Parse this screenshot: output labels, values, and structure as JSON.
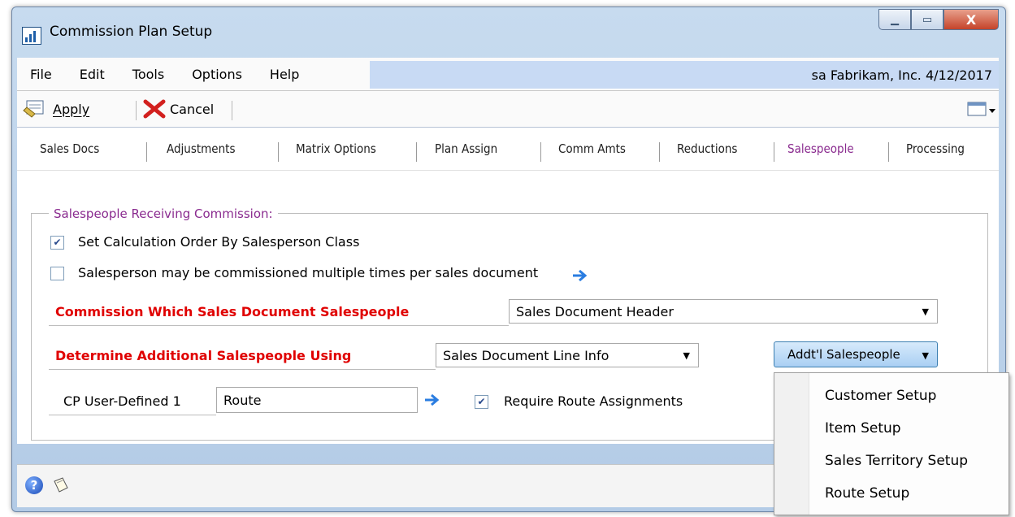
{
  "window": {
    "title": "Commission Plan Setup"
  },
  "menu": {
    "items": [
      "File",
      "Edit",
      "Tools",
      "Options",
      "Help"
    ],
    "user": "sa",
    "company": "Fabrikam, Inc.",
    "date": "4/12/2017"
  },
  "toolbar": {
    "apply_label": "Apply",
    "cancel_label": "Cancel"
  },
  "tabs": [
    "Sales Docs",
    "Adjustments",
    "Matrix Options",
    "Plan Assign",
    "Comm Amts",
    "Reductions",
    "Salespeople",
    "Processing"
  ],
  "active_tab": "Salespeople",
  "group": {
    "title": "Salespeople Receiving Commission:",
    "checkbox_calc_order": {
      "label": "Set Calculation Order By Salesperson Class",
      "checked": true
    },
    "checkbox_multiple": {
      "label": "Salesperson may be commissioned multiple times per sales document",
      "checked": false
    },
    "commission_which": {
      "label": "Commission Which Sales Document Salespeople",
      "value": "Sales Document Header"
    },
    "determine_additional": {
      "label": "Determine Additional Salespeople Using",
      "value": "Sales Document Line Info"
    },
    "addl_button_label": "Addt'l Salespeople",
    "user_defined": {
      "label": "CP User-Defined 1",
      "value": "Route"
    },
    "require_route": {
      "label": "Require Route Assignments",
      "checked": true
    }
  },
  "dropdown_menu": [
    "Customer Setup",
    "Item Setup",
    "Sales Territory Setup",
    "Route Setup"
  ]
}
